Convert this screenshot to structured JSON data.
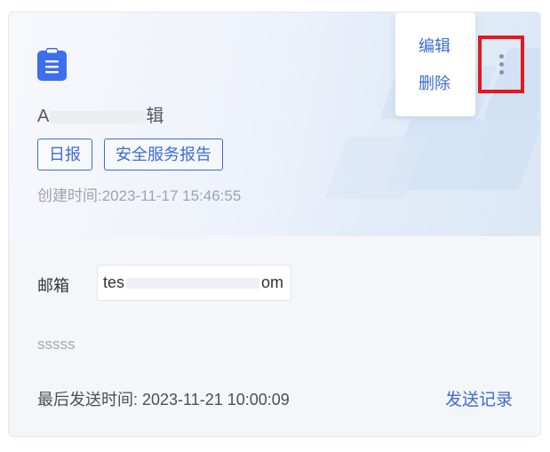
{
  "card": {
    "icon": "clipboard-icon",
    "title_prefix": "A",
    "title_suffix": "辑",
    "tags": [
      "日报",
      "安全服务报告"
    ],
    "created": "创建时间:2023-11-17 15:46:55",
    "menu": {
      "edit_label": "编辑",
      "delete_label": "删除"
    },
    "more_icon": "vertical-dots-icon",
    "email_label": "邮箱",
    "email_prefix": "tes",
    "email_suffix": "om",
    "note": "sssss",
    "last_sent": "最后发送时间: 2023-11-21 10:00:09",
    "records_label": "发送记录"
  },
  "colors": {
    "accent": "#3d6bd6",
    "highlight_border": "#e5171d",
    "icon_blue": "#3d6ef0"
  }
}
